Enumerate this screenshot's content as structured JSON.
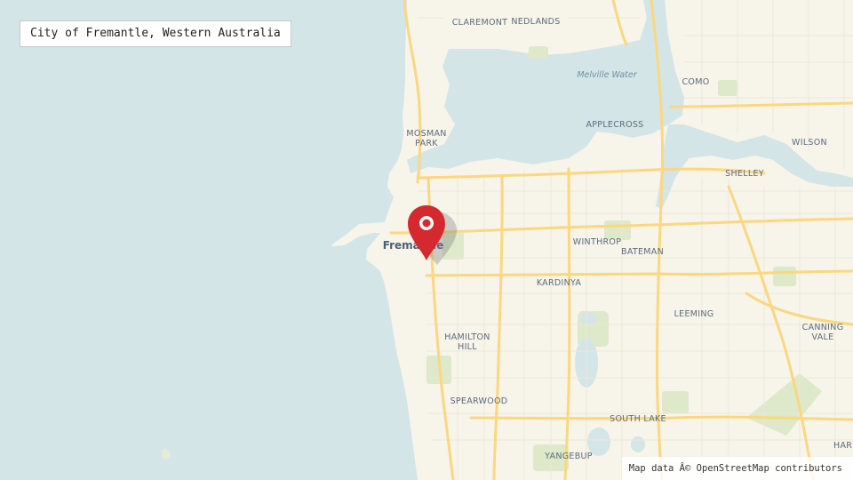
{
  "title": "City of Fremantle, Western Australia",
  "attribution": "Map data Â© OpenStreetMap contributors",
  "marker": {
    "icon": "location-pin-icon",
    "color": "#d42a2f"
  },
  "colors": {
    "sea": "#d4e5e7",
    "land": "#f7f4ea",
    "major_road": "#fbd77f",
    "minor_road": "#ffffff",
    "park": "#dde9c9"
  },
  "labels": {
    "claremont": "CLAREMONT",
    "nedlands": "NEDLANDS",
    "melville_water": "Melville Water",
    "como": "COMO",
    "applecross": "APPLECROSS",
    "mosman_park_1": "MOSMAN",
    "mosman_park_2": "PARK",
    "wilson": "WILSON",
    "shelley": "SHELLEY",
    "fremantle": "Fremantle",
    "winthrop": "WINTHROP",
    "bateman": "BATEMAN",
    "kardinya": "KARDINYA",
    "leeming": "LEEMING",
    "canning_vale_1": "CANNING",
    "canning_vale_2": "VALE",
    "hamilton_hill_1": "HAMILTON",
    "hamilton_hill_2": "HILL",
    "spearwood": "SPEARWOOD",
    "south_lake": "SOUTH LAKE",
    "yangebup": "YANGEBUP",
    "harrisdale_partial": "HAR"
  }
}
